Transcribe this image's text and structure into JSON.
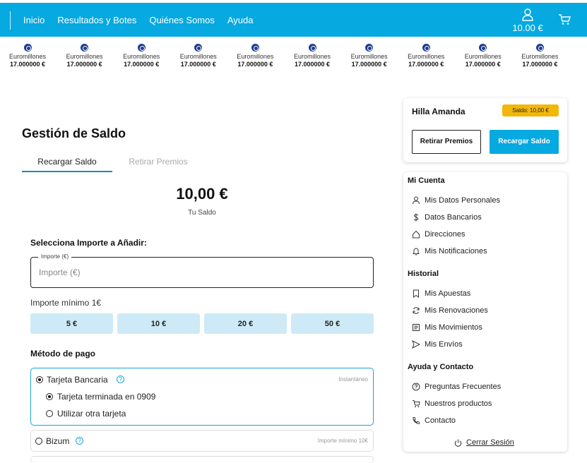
{
  "nav": {
    "items": [
      "Inicio",
      "Resultados y Botes",
      "Quiénes Somos",
      "Ayuda"
    ],
    "balance": "10.00 €"
  },
  "ticker": [
    {
      "name": "Euromillones",
      "amount": "17.000000 €"
    },
    {
      "name": "Euromillones",
      "amount": "17.000000 €"
    },
    {
      "name": "Euromillones",
      "amount": "17.000000 €"
    },
    {
      "name": "Euromillones",
      "amount": "17.000000 €"
    },
    {
      "name": "Euromillones",
      "amount": "17.000000 €"
    },
    {
      "name": "Euromillones",
      "amount": "17.000000 €"
    },
    {
      "name": "Euromillones",
      "amount": "17.000000 €"
    },
    {
      "name": "Euromillones",
      "amount": "17.000000 €"
    },
    {
      "name": "Euromillones",
      "amount": "17.000000 €"
    },
    {
      "name": "Euromillones",
      "amount": "17.000000 €"
    }
  ],
  "main": {
    "title": "Gestión de Saldo",
    "tabs": [
      "Recargar Saldo",
      "Retirar Premios"
    ],
    "balance_value": "10,00 €",
    "balance_label": "Tu Saldo",
    "select_label": "Selecciona Importe a Añadir:",
    "field_label": "Importe (€)",
    "field_placeholder": "Importe (€)",
    "min_label": "Importe mínimo 1€",
    "amounts": [
      "5 €",
      "10 €",
      "20 €",
      "50 €"
    ],
    "payment_label": "Método de pago",
    "card_option": "Tarjeta Bancaria",
    "card_hint": "Instantáneo",
    "saved_card": "Tarjeta terminada en 0909",
    "other_card": "Utilizar otra tarjeta",
    "bizum_option": "Bizum",
    "bizum_hint": "Importe mínimo 10€"
  },
  "sidebar": {
    "user_name": "Hilla Amanda",
    "badge": "Saldo: 10,00 €",
    "withdraw_button": "Retirar Premios",
    "recharge_button": "Recargar Saldo",
    "sections": [
      {
        "title": "Mi Cuenta",
        "items": [
          {
            "label": "Mis Datos Personales",
            "icon": "user-icon"
          },
          {
            "label": "Datos Bancarios",
            "icon": "dollar-icon"
          },
          {
            "label": "Direcciones",
            "icon": "home-icon"
          },
          {
            "label": "Mis Notificaciones",
            "icon": "bell-icon"
          }
        ]
      },
      {
        "title": "Historial",
        "items": [
          {
            "label": "Mis Apuestas",
            "icon": "bookmark-icon"
          },
          {
            "label": "Mis Renovaciones",
            "icon": "refresh-icon"
          },
          {
            "label": "Mis Movimientos",
            "icon": "list-icon"
          },
          {
            "label": "Mis Envíos",
            "icon": "send-icon"
          }
        ]
      },
      {
        "title": "Ayuda y Contacto",
        "items": [
          {
            "label": "Preguntas Frecuentes",
            "icon": "help-icon"
          },
          {
            "label": "Nuestros productos",
            "icon": "cart-icon"
          },
          {
            "label": "Contacto",
            "icon": "phone-icon"
          }
        ]
      }
    ],
    "logout": "Cerrar Sesión"
  },
  "colors": {
    "primary": "#06a9e0",
    "amount_bg": "#cdeaf6",
    "badge": "#f3b70a"
  }
}
